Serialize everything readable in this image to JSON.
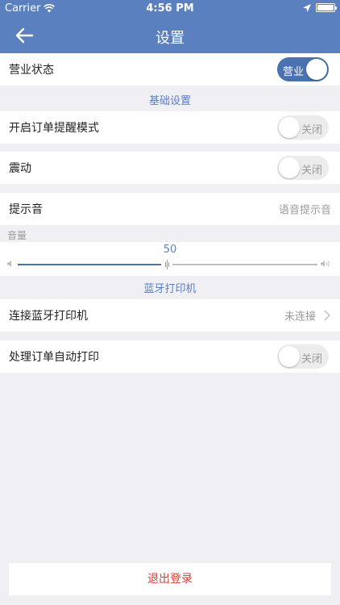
{
  "status_bar": {
    "carrier": "Carrier",
    "time": "4:56 PM"
  },
  "nav": {
    "title": "设置",
    "back_icon": "arrow-left-icon"
  },
  "business_status": {
    "label": "营业状态",
    "toggle_label": "营业",
    "on": true
  },
  "sections": {
    "basic": "基础设置",
    "bluetooth": "蓝牙打印机"
  },
  "order_reminder": {
    "label": "开启订单提醒模式",
    "toggle_label": "关闭",
    "on": false
  },
  "vibration": {
    "label": "震动",
    "toggle_label": "关闭",
    "on": false
  },
  "sound": {
    "label": "提示音",
    "value": "语音提示音"
  },
  "volume": {
    "label": "音量",
    "value": "50",
    "level": 50
  },
  "printer": {
    "label": "连接蓝牙打印机",
    "value": "未连接"
  },
  "auto_print": {
    "label": "处理订单自动打印",
    "toggle_label": "关闭",
    "on": false
  },
  "logout": {
    "label": "退出登录"
  },
  "colors": {
    "accent": "#5b80c0",
    "toggle_on": "#4a72b0",
    "danger": "#e23b3b"
  }
}
